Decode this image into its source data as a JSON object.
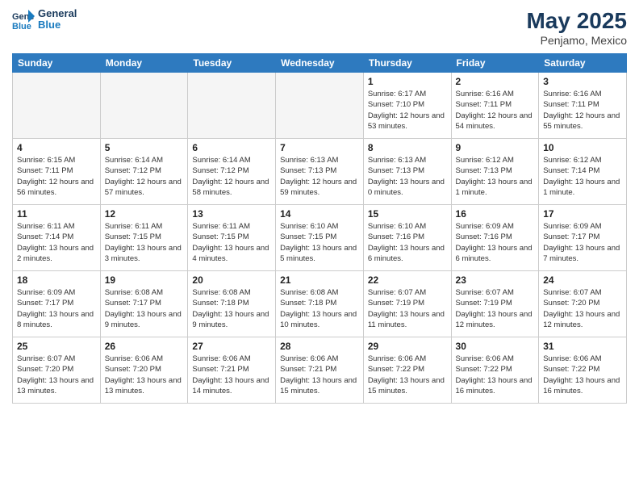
{
  "header": {
    "logo_general": "General",
    "logo_blue": "Blue",
    "month_year": "May 2025",
    "location": "Penjamo, Mexico"
  },
  "weekdays": [
    "Sunday",
    "Monday",
    "Tuesday",
    "Wednesday",
    "Thursday",
    "Friday",
    "Saturday"
  ],
  "weeks": [
    [
      {
        "day": "",
        "info": ""
      },
      {
        "day": "",
        "info": ""
      },
      {
        "day": "",
        "info": ""
      },
      {
        "day": "",
        "info": ""
      },
      {
        "day": "1",
        "info": "Sunrise: 6:17 AM\nSunset: 7:10 PM\nDaylight: 12 hours\nand 53 minutes."
      },
      {
        "day": "2",
        "info": "Sunrise: 6:16 AM\nSunset: 7:11 PM\nDaylight: 12 hours\nand 54 minutes."
      },
      {
        "day": "3",
        "info": "Sunrise: 6:16 AM\nSunset: 7:11 PM\nDaylight: 12 hours\nand 55 minutes."
      }
    ],
    [
      {
        "day": "4",
        "info": "Sunrise: 6:15 AM\nSunset: 7:11 PM\nDaylight: 12 hours\nand 56 minutes."
      },
      {
        "day": "5",
        "info": "Sunrise: 6:14 AM\nSunset: 7:12 PM\nDaylight: 12 hours\nand 57 minutes."
      },
      {
        "day": "6",
        "info": "Sunrise: 6:14 AM\nSunset: 7:12 PM\nDaylight: 12 hours\nand 58 minutes."
      },
      {
        "day": "7",
        "info": "Sunrise: 6:13 AM\nSunset: 7:13 PM\nDaylight: 12 hours\nand 59 minutes."
      },
      {
        "day": "8",
        "info": "Sunrise: 6:13 AM\nSunset: 7:13 PM\nDaylight: 13 hours\nand 0 minutes."
      },
      {
        "day": "9",
        "info": "Sunrise: 6:12 AM\nSunset: 7:13 PM\nDaylight: 13 hours\nand 1 minute."
      },
      {
        "day": "10",
        "info": "Sunrise: 6:12 AM\nSunset: 7:14 PM\nDaylight: 13 hours\nand 1 minute."
      }
    ],
    [
      {
        "day": "11",
        "info": "Sunrise: 6:11 AM\nSunset: 7:14 PM\nDaylight: 13 hours\nand 2 minutes."
      },
      {
        "day": "12",
        "info": "Sunrise: 6:11 AM\nSunset: 7:15 PM\nDaylight: 13 hours\nand 3 minutes."
      },
      {
        "day": "13",
        "info": "Sunrise: 6:11 AM\nSunset: 7:15 PM\nDaylight: 13 hours\nand 4 minutes."
      },
      {
        "day": "14",
        "info": "Sunrise: 6:10 AM\nSunset: 7:15 PM\nDaylight: 13 hours\nand 5 minutes."
      },
      {
        "day": "15",
        "info": "Sunrise: 6:10 AM\nSunset: 7:16 PM\nDaylight: 13 hours\nand 6 minutes."
      },
      {
        "day": "16",
        "info": "Sunrise: 6:09 AM\nSunset: 7:16 PM\nDaylight: 13 hours\nand 6 minutes."
      },
      {
        "day": "17",
        "info": "Sunrise: 6:09 AM\nSunset: 7:17 PM\nDaylight: 13 hours\nand 7 minutes."
      }
    ],
    [
      {
        "day": "18",
        "info": "Sunrise: 6:09 AM\nSunset: 7:17 PM\nDaylight: 13 hours\nand 8 minutes."
      },
      {
        "day": "19",
        "info": "Sunrise: 6:08 AM\nSunset: 7:17 PM\nDaylight: 13 hours\nand 9 minutes."
      },
      {
        "day": "20",
        "info": "Sunrise: 6:08 AM\nSunset: 7:18 PM\nDaylight: 13 hours\nand 9 minutes."
      },
      {
        "day": "21",
        "info": "Sunrise: 6:08 AM\nSunset: 7:18 PM\nDaylight: 13 hours\nand 10 minutes."
      },
      {
        "day": "22",
        "info": "Sunrise: 6:07 AM\nSunset: 7:19 PM\nDaylight: 13 hours\nand 11 minutes."
      },
      {
        "day": "23",
        "info": "Sunrise: 6:07 AM\nSunset: 7:19 PM\nDaylight: 13 hours\nand 12 minutes."
      },
      {
        "day": "24",
        "info": "Sunrise: 6:07 AM\nSunset: 7:20 PM\nDaylight: 13 hours\nand 12 minutes."
      }
    ],
    [
      {
        "day": "25",
        "info": "Sunrise: 6:07 AM\nSunset: 7:20 PM\nDaylight: 13 hours\nand 13 minutes."
      },
      {
        "day": "26",
        "info": "Sunrise: 6:06 AM\nSunset: 7:20 PM\nDaylight: 13 hours\nand 13 minutes."
      },
      {
        "day": "27",
        "info": "Sunrise: 6:06 AM\nSunset: 7:21 PM\nDaylight: 13 hours\nand 14 minutes."
      },
      {
        "day": "28",
        "info": "Sunrise: 6:06 AM\nSunset: 7:21 PM\nDaylight: 13 hours\nand 15 minutes."
      },
      {
        "day": "29",
        "info": "Sunrise: 6:06 AM\nSunset: 7:22 PM\nDaylight: 13 hours\nand 15 minutes."
      },
      {
        "day": "30",
        "info": "Sunrise: 6:06 AM\nSunset: 7:22 PM\nDaylight: 13 hours\nand 16 minutes."
      },
      {
        "day": "31",
        "info": "Sunrise: 6:06 AM\nSunset: 7:22 PM\nDaylight: 13 hours\nand 16 minutes."
      }
    ]
  ]
}
